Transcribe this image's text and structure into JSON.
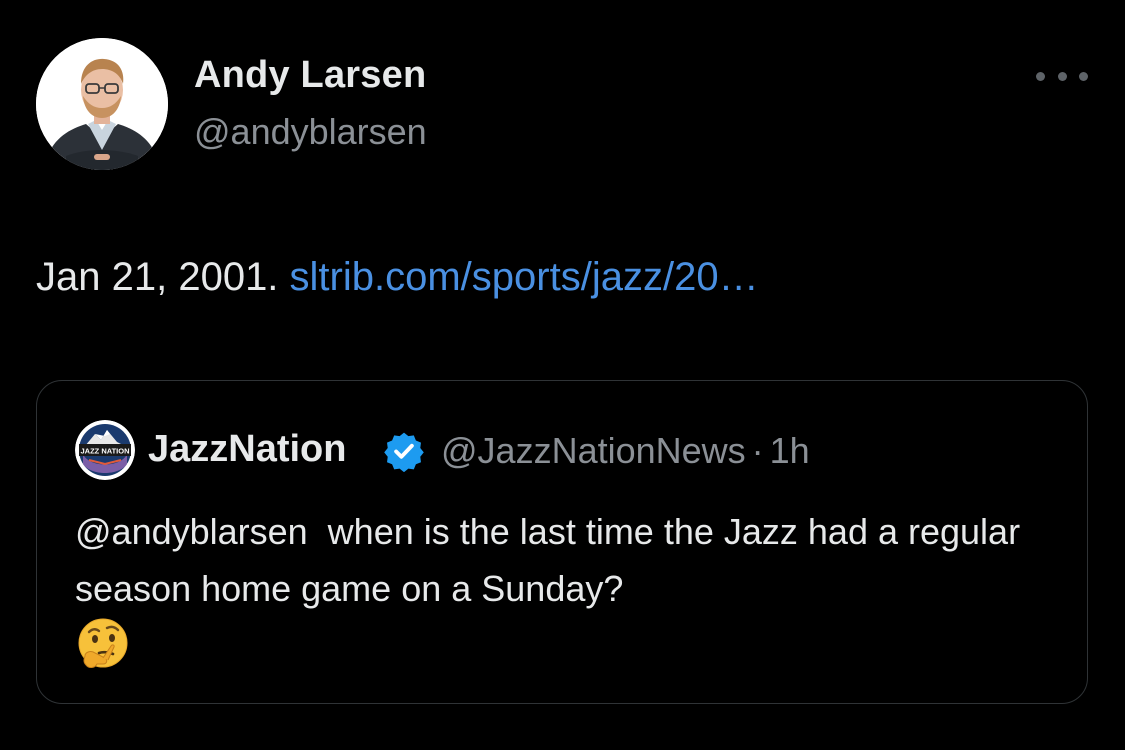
{
  "author": {
    "display_name": "Andy Larsen",
    "handle": "@andyblarsen",
    "avatar_icon": "person-photo-avatar"
  },
  "more_icon": "ellipsis-icon",
  "tweet": {
    "text": "Jan 21, 2001.",
    "link_text": "sltrib.com/sports/jazz/20…"
  },
  "quoted_tweet": {
    "display_name": "JazzNation",
    "verified": true,
    "handle": "@JazzNationNews",
    "separator": "·",
    "time": "1h",
    "avatar_logo_text": "JAZZ NATION",
    "body": "@andyblarsen  when is the last time the Jazz had a regular season home game on a Sunday?",
    "emoji": "thinking-face"
  },
  "colors": {
    "background": "#000000",
    "text": "#e7e9ea",
    "muted": "#8b9096",
    "link": "#4a90e2",
    "verified": "#1d9bf0",
    "border": "#2f3336"
  }
}
